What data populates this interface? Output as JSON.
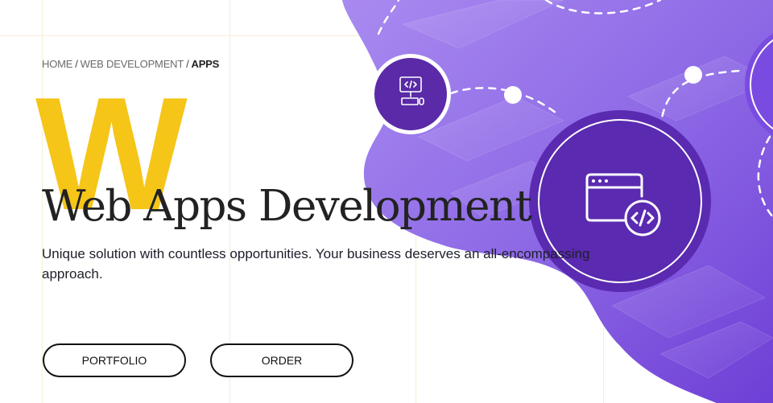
{
  "breadcrumb": {
    "items": [
      {
        "label": "HOME"
      },
      {
        "label": "WEB DEVELOPMENT"
      },
      {
        "label": "APPS"
      }
    ],
    "separator": "/"
  },
  "hero": {
    "decor_letter": "W",
    "title": "Web Apps Development",
    "subtitle": "Unique solution with countless opportunities. Your business deserves an all-encompassing approach."
  },
  "buttons": {
    "portfolio_label": "PORTFOLIO",
    "order_label": "ORDER"
  },
  "icons": {
    "small_badge": "computer-code-icon",
    "large_badge": "browser-code-icon"
  },
  "colors": {
    "accent_purple": "#8e5bea",
    "dark_purple": "#5a2aa8",
    "accent_yellow": "#f5c518",
    "text_dark": "#222222"
  }
}
